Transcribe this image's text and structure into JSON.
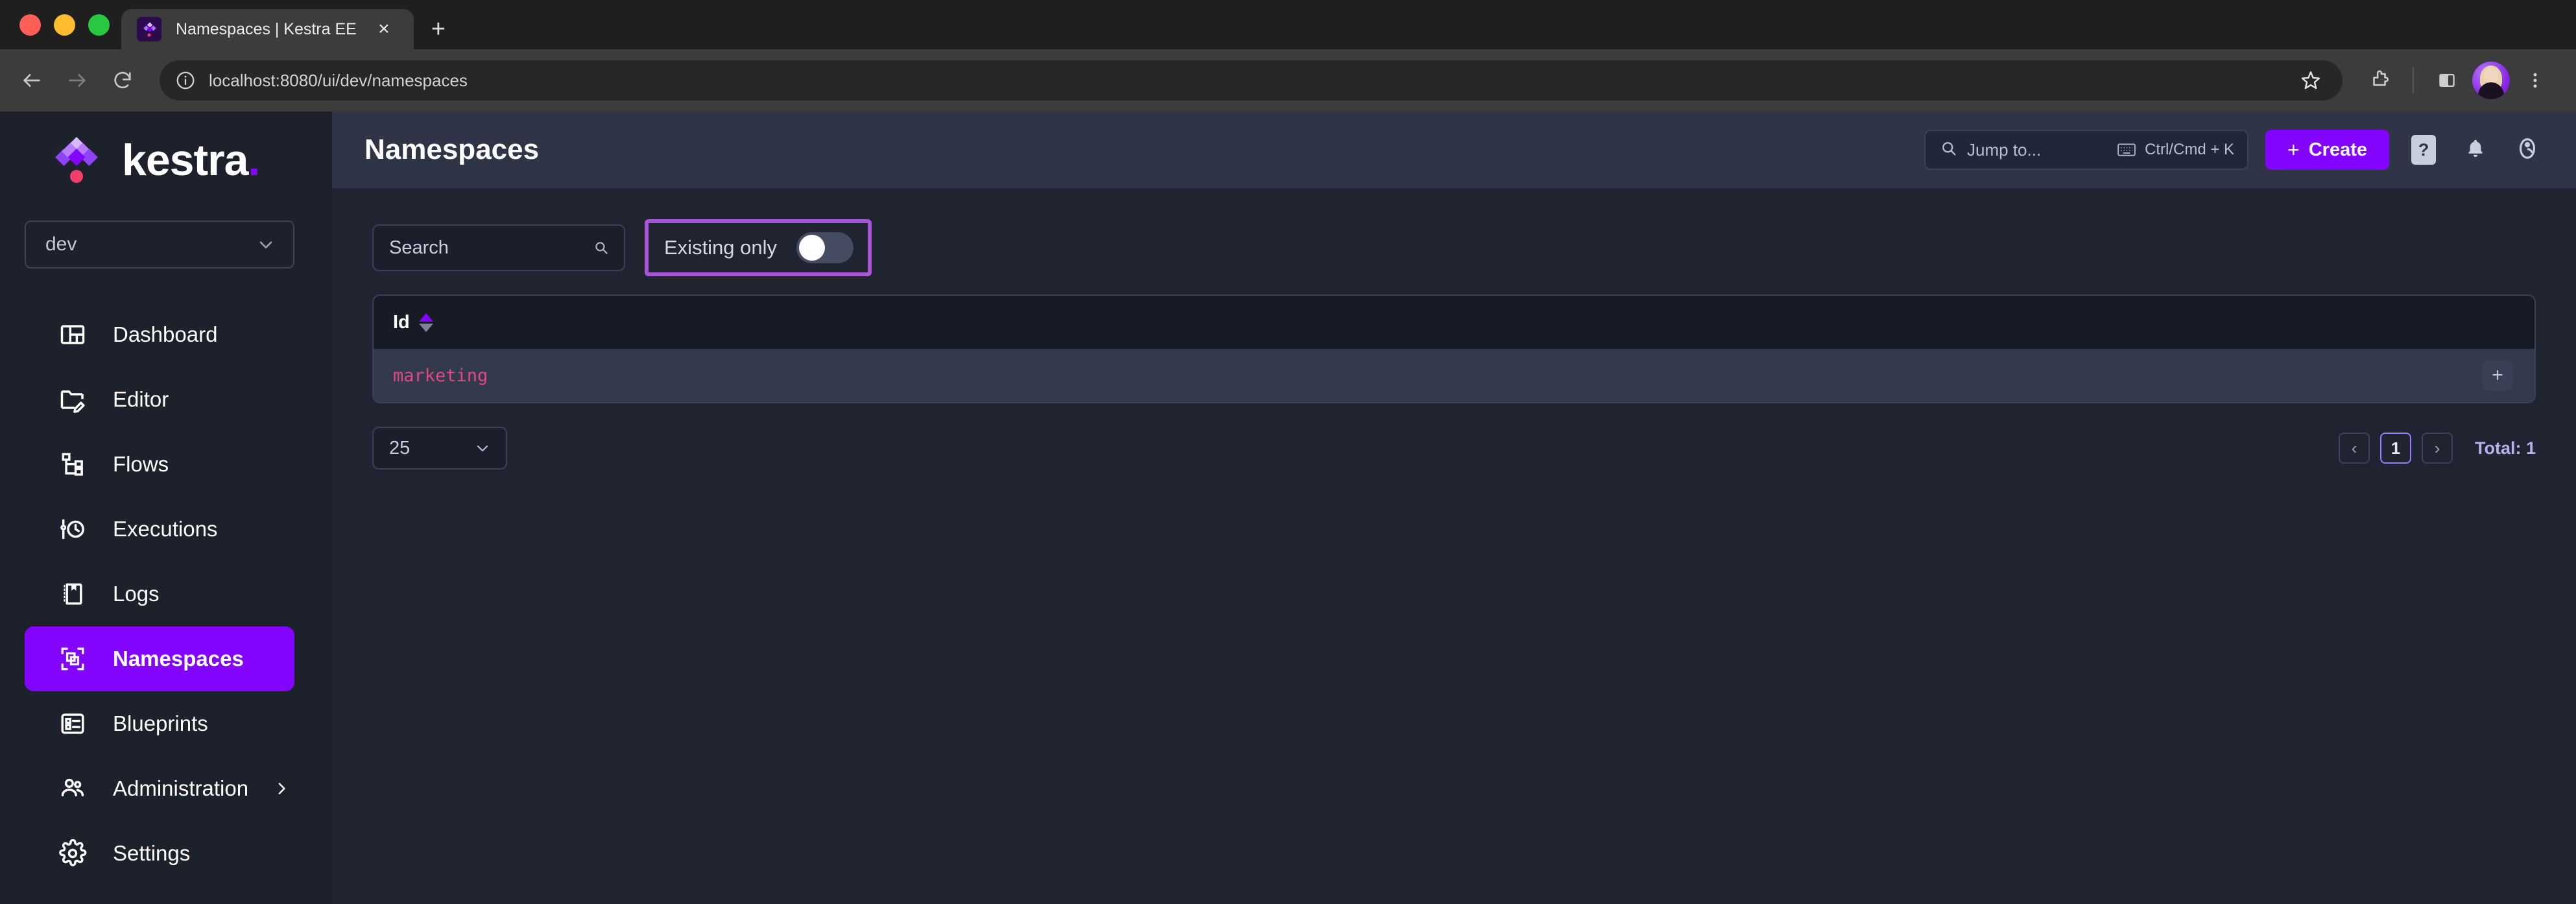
{
  "browser": {
    "tab": {
      "title": "Namespaces | Kestra EE",
      "favicon": "kestra-logo-icon",
      "close": "×"
    },
    "new_tab": "+",
    "nav": {
      "back": "back-arrow-icon",
      "forward": "forward-arrow-icon",
      "reload": "reload-icon"
    },
    "url": "localhost:8080/ui/dev/namespaces",
    "site_info": "info-circle-icon",
    "toolbar_icons": [
      "bookmark-star-icon",
      "extensions-puzzle-icon",
      "side-panel-icon",
      "profile-avatar",
      "kebab-menu-icon"
    ]
  },
  "sidebar": {
    "logo": {
      "text": "kestra",
      "accent": "."
    },
    "namespace_select": {
      "value": "dev",
      "chevron": "chevron-down-icon"
    },
    "items": [
      {
        "label": "Dashboard",
        "icon": "dashboard-icon",
        "active": false
      },
      {
        "label": "Editor",
        "icon": "folder-edit-icon",
        "active": false
      },
      {
        "label": "Flows",
        "icon": "flows-topology-icon",
        "active": false
      },
      {
        "label": "Executions",
        "icon": "timeline-clock-icon",
        "active": false
      },
      {
        "label": "Logs",
        "icon": "book-icon",
        "active": false
      },
      {
        "label": "Namespaces",
        "icon": "namespace-selection-icon",
        "active": true
      },
      {
        "label": "Blueprints",
        "icon": "card-list-icon",
        "active": false
      },
      {
        "label": "Administration",
        "icon": "account-group-icon",
        "active": false,
        "chevron": "chevron-right-icon"
      },
      {
        "label": "Settings",
        "icon": "cog-icon",
        "active": false
      }
    ]
  },
  "header": {
    "title": "Namespaces",
    "jump_to": {
      "placeholder": "Jump to...",
      "shortcut": "Ctrl/Cmd + K",
      "search_icon": "search-icon",
      "keyboard_icon": "keyboard-icon"
    },
    "create_button": {
      "label": "Create",
      "plus": "+"
    },
    "help_icon": "?",
    "notifications_icon": "bell-icon",
    "account_icon": "account-circle-icon"
  },
  "filters": {
    "search": {
      "placeholder": "Search",
      "value": "",
      "icon": "search-icon"
    },
    "existing_only": {
      "label": "Existing only",
      "enabled": false
    }
  },
  "table": {
    "columns": [
      {
        "label": "Id",
        "sort": "asc"
      }
    ],
    "rows": [
      {
        "id": "marketing",
        "add": "+"
      }
    ]
  },
  "pagination": {
    "page_size": "25",
    "page_size_chevron": "chevron-down-icon",
    "prev": "‹",
    "current_page": "1",
    "next": "›",
    "total": "Total: 1"
  },
  "colors": {
    "accent": "#8405ff",
    "highlight_box": "#a855d8",
    "row_id_text": "#e2487f",
    "topbar_bg": "#2f3446",
    "sidebar_bg": "#1c212c",
    "content_bg": "#1f2430"
  }
}
